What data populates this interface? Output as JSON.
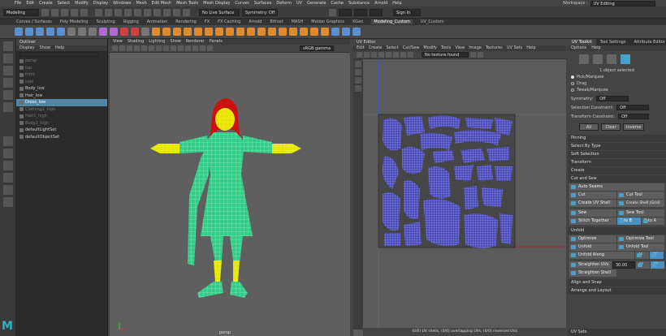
{
  "menubar": {
    "items": [
      "File",
      "Edit",
      "Create",
      "Select",
      "Modify",
      "Display",
      "Windows",
      "Mesh",
      "Edit Mesh",
      "Mesh Tools",
      "Mesh Display",
      "Curves",
      "Surfaces",
      "Deform",
      "UV",
      "Generate",
      "Cache",
      "Substance",
      "Arnold",
      "Help"
    ],
    "workspace_label": "Workspace :",
    "workspace_value": "UV Editing"
  },
  "statusline": {
    "mode": "Modeling",
    "live_surface": "No Live Surface",
    "symmetry": "Symmetry: Off",
    "signin": "Sign In"
  },
  "shelf": {
    "tabs": [
      "Curves / Surfaces",
      "Poly Modeling",
      "Sculpting",
      "Rigging",
      "Animation",
      "Rendering",
      "FX",
      "FX Caching",
      "Arnold",
      "Bifrost",
      "MASH",
      "Motion Graphics",
      "XGen",
      "Modeling_Custom",
      "UV_Custom"
    ],
    "active_tab": "Modeling_Custom"
  },
  "outliner": {
    "title": "Outliner",
    "menu": [
      "Display",
      "Show",
      "Help"
    ],
    "items": [
      {
        "label": "persp",
        "dim": true
      },
      {
        "label": "top",
        "dim": true
      },
      {
        "label": "front",
        "dim": true
      },
      {
        "label": "side",
        "dim": true
      },
      {
        "label": "Body_low",
        "dim": false
      },
      {
        "label": "Hair_low",
        "dim": false
      },
      {
        "label": "Dress_low",
        "dim": false,
        "selected": true
      },
      {
        "label": "Clothing1_high",
        "dim": true
      },
      {
        "label": "Hair1_high",
        "dim": true
      },
      {
        "label": "Body1_high",
        "dim": true
      },
      {
        "label": "defaultLightSet",
        "dim": false
      },
      {
        "label": "defaultObjectSet",
        "dim": false
      }
    ]
  },
  "viewport": {
    "menu": [
      "View",
      "Shading",
      "Lighting",
      "Show",
      "Renderer",
      "Panels"
    ],
    "colorspace": "sRGB gamma",
    "camera": "persp"
  },
  "uv_editor": {
    "title": "UV Editor",
    "menu": [
      "Edit",
      "Create",
      "Select",
      "Cut/Sew",
      "Modify",
      "Tools",
      "View",
      "Image",
      "Textures",
      "UV Sets",
      "Help"
    ],
    "texture_field": "No texture found",
    "status": "(0/0) UV shells, (0/0) overlapping UVs, (0/0) reversed UVs"
  },
  "uv_toolkit": {
    "tabs": [
      "UV Toolkit",
      "Tool Settings",
      "Attribute Editor"
    ],
    "menu": [
      "Options",
      "Help"
    ],
    "selected_count": "1 object selected",
    "modes": [
      "Pick/Marquee",
      "Drag",
      "Tweak/Marquee"
    ],
    "symmetry_label": "Symmetry:",
    "symmetry_value": "Off",
    "selection_constraint_label": "Selection Constraint:",
    "selection_constraint_value": "Off",
    "transform_constraint_label": "Transform Constraint:",
    "transform_constraint_value": "Off",
    "quick_buttons": [
      "All",
      "Clear",
      "Inverse"
    ],
    "sections": {
      "pinning": "Pinning",
      "select_by_type": "Select By Type",
      "soft_selection": "Soft Selection",
      "transform": "Transform",
      "create": "Create",
      "cut_and_sew": "Cut and Sew",
      "unfold": "Unfold",
      "align_and_snap": "Align and Snap",
      "arrange_and_layout": "Arrange and Layout",
      "uv_sets": "UV Sets"
    },
    "cut_sew": {
      "auto_seams": "Auto Seams",
      "cut": "Cut",
      "cut_tool": "Cut Tool",
      "create_uv_shell": "Create UV Shell",
      "create_shell_grid": "Create Shell (Grid)",
      "sew": "Sew",
      "sew_tool": "Sew Tool",
      "stitch_together": "Stitch Together",
      "a_to_b": "A to B",
      "b_to_a": "B to A"
    },
    "unfold": {
      "optimize": "Optimize",
      "optimize_tool": "Optimize Tool",
      "unfold": "Unfold",
      "unfold_tool": "Unfold Tool",
      "unfold_along": "Unfold Along",
      "u": "U",
      "v": "V",
      "straighten_uvs": "Straighten UVs",
      "straighten_value": "30.00",
      "straighten_shell": "Straighten Shell"
    }
  },
  "colors": {
    "accent": "#5285a6",
    "mesh_green": "#33cc88",
    "mesh_yellow": "#e6e600",
    "hair_red": "#cc1111",
    "uv_blue": "#5a5ac8"
  }
}
